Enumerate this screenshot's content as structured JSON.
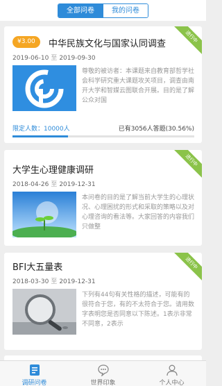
{
  "header": {
    "tabs": [
      {
        "label": "全部问卷",
        "active": true
      },
      {
        "label": "我的问卷",
        "active": false
      }
    ]
  },
  "surveys": [
    {
      "status": "进行中",
      "reward": "¥3.00",
      "title": "中华民族文化与国家认同调查",
      "start": "2019-06-10",
      "sep": "至",
      "end": "2019-09-30",
      "image_icon": "blue-logo-icon",
      "description": "尊敬的被访者：本课题来自教育部哲学社会科学研究重大课题攻关项目，调查由南开大学和智媒云图联合开展。目的是了解公众对国",
      "quota": "限定人数：10000人",
      "answered": "已有3056人答题(30.56%)",
      "progress": 30.56
    },
    {
      "status": "进行中",
      "title": "大学生心理健康调研",
      "start": "2018-04-26",
      "sep": "至",
      "end": "2019-12-31",
      "image_icon": "sprout-in-sky-photo",
      "description": "本问卷的目的是了解当前大学生的心理状况、心理困扰的形式和采取的策略以及对心理咨询的看法等。大家回答的内容我们只做整"
    },
    {
      "status": "进行中",
      "title": "BFI大五量表",
      "start": "2018-03-30",
      "sep": "至",
      "end": "2019-12-31",
      "image_icon": "magnifier-photo",
      "description": "下列有44句有关性格的描述，可能有的很符合于您，有的不太符合于您。请用数字表明您是否同意以下陈述。1表示非常不同意，2表示"
    }
  ],
  "tabbar": [
    {
      "label": "调研问卷",
      "icon": "survey-icon",
      "active": true
    },
    {
      "label": "世界印象",
      "icon": "chat-bubble-icon",
      "active": false
    },
    {
      "label": "个人中心",
      "icon": "person-icon",
      "active": false
    }
  ],
  "colors": {
    "accent": "#2e8bd9",
    "ribbon": "#8bc34a",
    "reward": "#f5a623"
  }
}
